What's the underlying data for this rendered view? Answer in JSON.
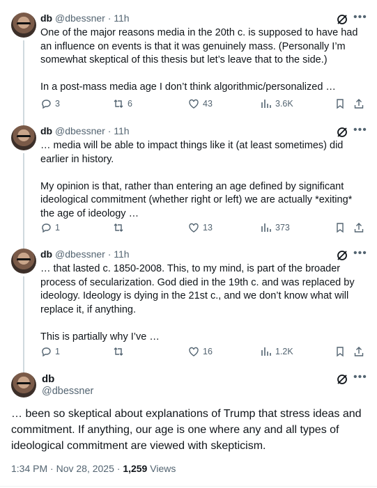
{
  "thread": [
    {
      "name": "db",
      "handle": "@dbessner",
      "sep": "·",
      "time": "11h",
      "text": "One of the major reasons media in the 20th c. is supposed to have had an influence on events is that it was genuinely mass. (Personally I’m somewhat skeptical of this thesis but let’s leave that to the side.)\n\nIn a post-mass media age I don’t think algorithmic/personalized …",
      "replies": "3",
      "reposts": "6",
      "likes": "43",
      "views": "3.6K"
    },
    {
      "name": "db",
      "handle": "@dbessner",
      "sep": "·",
      "time": "11h",
      "text": "… media will be able to impact things like it (at least sometimes) did earlier in history.\n\nMy opinion is that, rather than entering an age defined by significant ideological commitment (whether right or left) we are actually *exiting* the age of ideology …",
      "replies": "1",
      "reposts": "",
      "likes": "13",
      "views": "373"
    },
    {
      "name": "db",
      "handle": "@dbessner",
      "sep": "·",
      "time": "11h",
      "text": "… that lasted c. 1850-2008. This, to my mind, is part of the broader process of secularization. God died in the 19th c. and was replaced by ideology. Ideology is dying in the 21st c., and we don’t know what will replace it, if anything.\n\nThis is partially why I’ve …",
      "replies": "1",
      "reposts": "",
      "likes": "16",
      "views": "1.2K"
    }
  ],
  "main_tweet": {
    "name": "db",
    "handle": "@dbessner",
    "text": "… been so skeptical about explanations of Trump that stress ideas and commitment. If anything, our age is one where any and all types of ideological commitment are viewed with skepticism.",
    "timestamp": "1:34 PM · Nov 28, 2025 · ",
    "views_count": "1,259",
    "views_label": " Views"
  },
  "icons": [
    "grok-icon",
    "more-icon",
    "reply-icon",
    "repost-icon",
    "like-icon",
    "views-icon",
    "bookmark-icon",
    "share-icon"
  ],
  "colors": {
    "text": "#0f1419",
    "secondary": "#536471",
    "thread_line": "#cfd9de"
  }
}
